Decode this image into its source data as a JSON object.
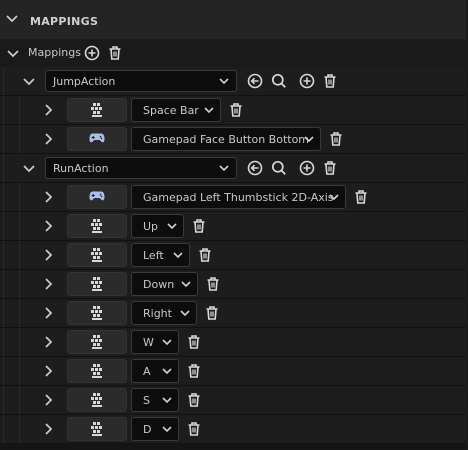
{
  "section": {
    "title": "MAPPINGS"
  },
  "mappings_label": "Mappings",
  "actions": [
    {
      "name": "JumpAction",
      "mappings": [
        {
          "device": "keyboard-icon",
          "key": "Space Bar"
        },
        {
          "device": "gamepad-icon",
          "key": "Gamepad Face Button Bottom"
        }
      ]
    },
    {
      "name": "RunAction",
      "mappings": [
        {
          "device": "gamepad-icon",
          "key": "Gamepad Left Thumbstick 2D-Axis"
        },
        {
          "device": "keyboard-icon",
          "key": "Up"
        },
        {
          "device": "keyboard-icon",
          "key": "Left"
        },
        {
          "device": "keyboard-icon",
          "key": "Down"
        },
        {
          "device": "keyboard-icon",
          "key": "Right"
        },
        {
          "device": "keyboard-icon",
          "key": "W"
        },
        {
          "device": "keyboard-icon",
          "key": "A"
        },
        {
          "device": "keyboard-icon",
          "key": "S"
        },
        {
          "device": "keyboard-icon",
          "key": "D"
        }
      ]
    }
  ],
  "colors": {
    "background": "#151515",
    "header": "#242424",
    "text": "#c8c8c8",
    "icon": "#d8d8d8"
  }
}
